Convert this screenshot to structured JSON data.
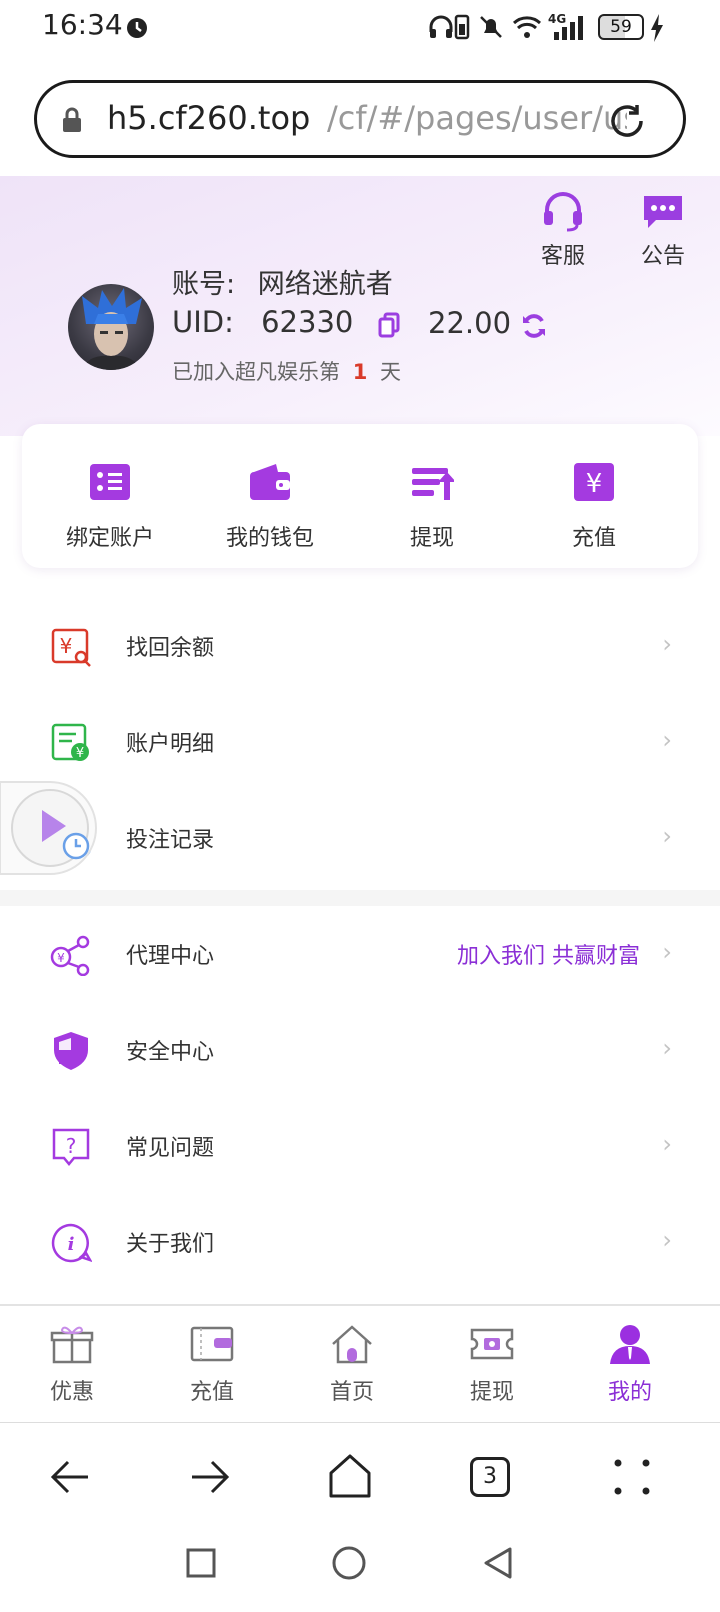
{
  "status_bar": {
    "time": "16:34",
    "battery": "59",
    "network": "4G"
  },
  "address_bar": {
    "host": "h5.cf260.top",
    "path": "/cf/#/pages/user/us"
  },
  "header": {
    "service_label": "客服",
    "notice_label": "公告",
    "account_label": "账号:",
    "account_name": "网络迷航者",
    "uid_label": "UID:",
    "uid_value": "62330",
    "balance": "22.00",
    "joined_prefix": "已加入超凡娱乐第",
    "joined_days": "1",
    "joined_suffix": "天"
  },
  "actions": [
    {
      "label": "绑定账户",
      "icon": "bind-account-icon"
    },
    {
      "label": "我的钱包",
      "icon": "wallet-icon"
    },
    {
      "label": "提现",
      "icon": "withdraw-icon"
    },
    {
      "label": "充值",
      "icon": "recharge-icon"
    }
  ],
  "menu": [
    {
      "label": "找回余额",
      "icon": "recover-balance-icon"
    },
    {
      "label": "账户明细",
      "icon": "account-details-icon"
    },
    {
      "label": "投注记录",
      "icon": "bet-record-icon"
    },
    {
      "label": "代理中心",
      "icon": "agent-center-icon",
      "extra": "加入我们 共赢财富"
    },
    {
      "label": "安全中心",
      "icon": "security-shield-icon"
    },
    {
      "label": "常见问题",
      "icon": "faq-icon"
    },
    {
      "label": "关于我们",
      "icon": "info-icon"
    }
  ],
  "tabs": [
    {
      "label": "优惠",
      "icon": "gift-icon"
    },
    {
      "label": "充值",
      "icon": "card-icon"
    },
    {
      "label": "首页",
      "icon": "home-icon"
    },
    {
      "label": "提现",
      "icon": "ticket-icon"
    },
    {
      "label": "我的",
      "icon": "user-icon",
      "active": true
    }
  ],
  "browser_nav": {
    "tab_count": "3"
  },
  "colors": {
    "accent": "#8b2fd6",
    "red": "#d93a2a",
    "green": "#2fb54a"
  }
}
